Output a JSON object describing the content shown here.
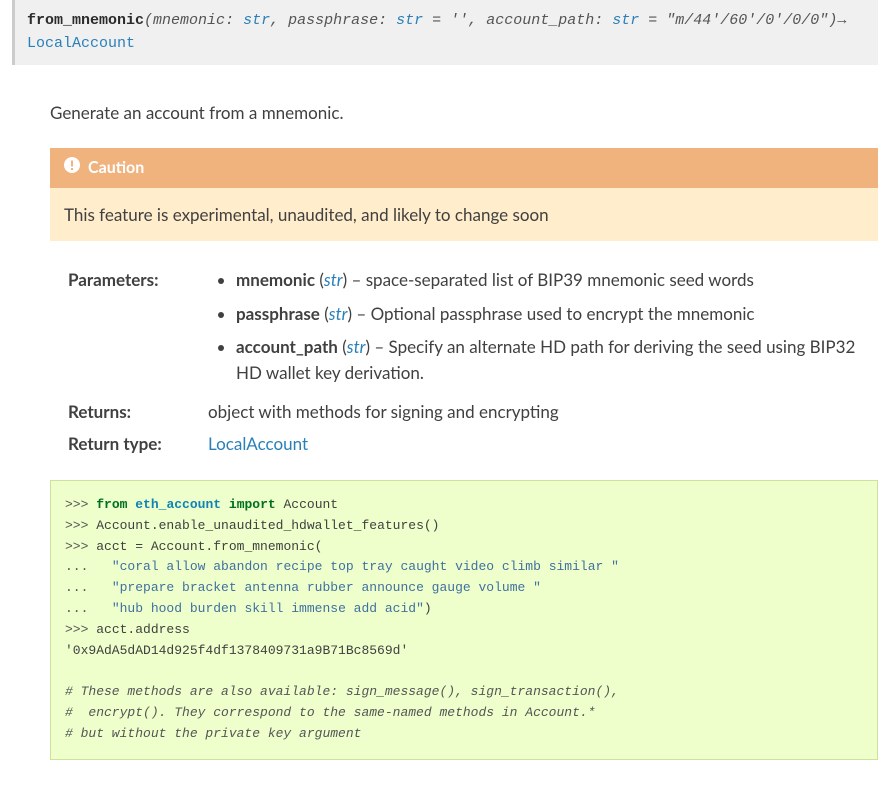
{
  "signature": {
    "fn_name": "from_mnemonic",
    "param1_name": "mnemonic",
    "param1_type": "str",
    "param2_name": "passphrase",
    "param2_type": "str",
    "param2_default": "''",
    "param3_name": "account_path",
    "param3_type": "str",
    "param3_default": "\"m/44'/60'/0'/0/0\"",
    "return_type": "LocalAccount",
    "sep_colon": ": ",
    "sep_eq": " = ",
    "open": "(",
    "comma": ", ",
    "close": ")",
    "arrow": "→ "
  },
  "desc": "Generate an account from a mnemonic.",
  "caution": {
    "title": "Caution",
    "text": "This feature is experimental, unaudited, and likely to change soon"
  },
  "fields": {
    "parameters_label": "Parameters:",
    "returns_label": "Returns:",
    "return_type_label": "Return type:",
    "returns_text": "object with methods for signing and encrypting",
    "return_type_value": "LocalAccount"
  },
  "params": [
    {
      "name": "mnemonic",
      "type": "str",
      "desc": " – space-separated list of BIP39 mnemonic seed words"
    },
    {
      "name": "passphrase",
      "type": "str",
      "desc": " – Optional passphrase used to encrypt the mnemonic"
    },
    {
      "name": "account_path",
      "type": "str",
      "desc": " – Specify an alternate HD path for deriving the seed using BIP32 HD wallet key derivation."
    }
  ],
  "code": {
    "p": ">>> ",
    "c": "... ",
    "l1_kw1": "from",
    "l1_mod": "eth_account",
    "l1_kw2": "import",
    "l1_rest": " Account",
    "l2": "Account.enable_unaudited_hdwallet_features()",
    "l3": "acct = Account.from_mnemonic(",
    "l4_indent": "  ",
    "l4_str": "\"coral allow abandon recipe top tray caught video climb similar \"",
    "l5_indent": "  ",
    "l5_str": "\"prepare bracket antenna rubber announce gauge volume \"",
    "l6_indent": "  ",
    "l6_str": "\"hub hood burden skill immense add acid\"",
    "l6_end": ")",
    "l7": "acct.address",
    "l8": "'0x9AdA5dAD14d925f4df1378409731a9B71Bc8569d'",
    "blank": "",
    "c1": "# These methods are also available: sign_message(), sign_transaction(),",
    "c2": "#  encrypt(). They correspond to the same-named methods in Account.*",
    "c3": "# but without the private key argument"
  }
}
